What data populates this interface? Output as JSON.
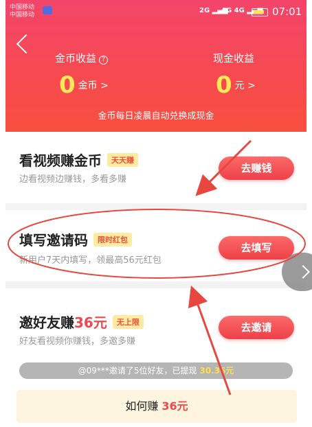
{
  "status": {
    "carrier1": "中国移动",
    "carrier2": "中国移动",
    "net1": "2G",
    "net2": "4G",
    "net3": "4G",
    "time": "07:01"
  },
  "header": {
    "coin_title": "金币收益",
    "coin_value": "0",
    "coin_unit": "金币 >",
    "cash_title": "现金收益",
    "cash_value": "0",
    "cash_unit": "元 >",
    "notice": "金币每日凌晨自动兑换成现金"
  },
  "tasks": [
    {
      "title": "看视频赚金币",
      "tag": "天天赚",
      "subtitle": "边看视频边赚钱，多看多赚",
      "button": "去赚钱"
    },
    {
      "title": "填写邀请码",
      "tag": "限时红包",
      "subtitle": "新用户7天内填写，领最高56元红包",
      "button": "去填写"
    },
    {
      "title_prefix": "邀好友赚",
      "title_amount": "36元",
      "tag": "无上限",
      "subtitle": "好友看视频你赚钱，多邀多赚",
      "button": "去邀请"
    }
  ],
  "invite_ticker": {
    "text": "@09***邀请了5位好友，已提现 ",
    "amount": "30.36元"
  },
  "how_to": {
    "prefix": "如何赚 ",
    "amount": "36元"
  },
  "colors": {
    "accent": "#f0474e",
    "header": "#f64a4f",
    "tag_bg": "#ffeaa2",
    "annotation": "#e8473f"
  }
}
